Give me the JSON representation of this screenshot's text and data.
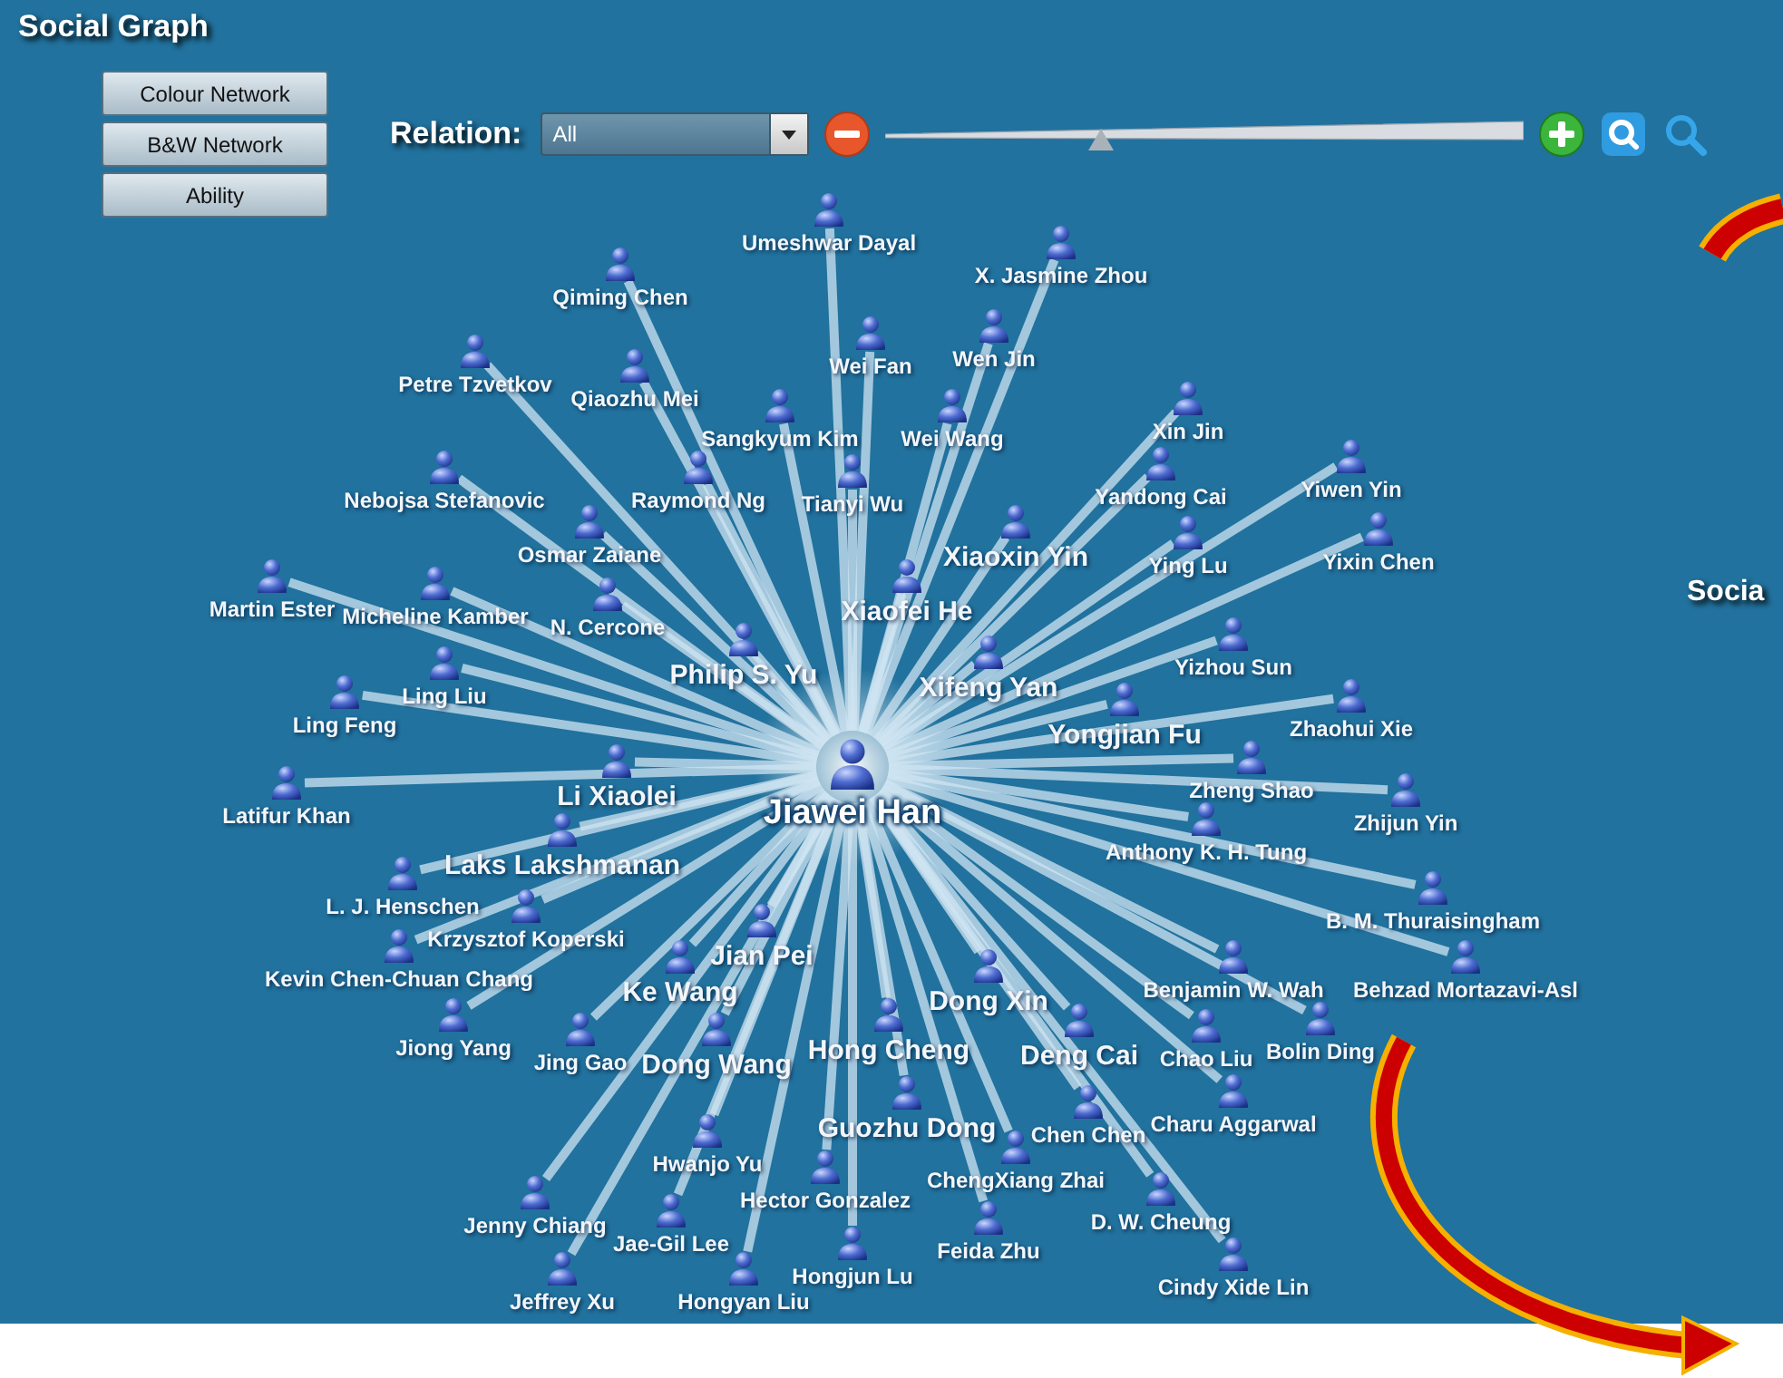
{
  "title": "Social Graph",
  "view_buttons": [
    "Colour Network",
    "B&W Network",
    "Ability"
  ],
  "relation": {
    "label": "Relation:",
    "value": "All"
  },
  "zoom": {
    "level": 0.34
  },
  "graph": {
    "center": {
      "name": "Jiawei Han"
    },
    "nodes": [
      {
        "name": "Umeshwar Dayal",
        "kind": "minor"
      },
      {
        "name": "X. Jasmine Zhou",
        "kind": "minor"
      },
      {
        "name": "Qiming Chen",
        "kind": "minor"
      },
      {
        "name": "Wen Jin",
        "kind": "minor"
      },
      {
        "name": "Wei Fan",
        "kind": "minor"
      },
      {
        "name": "Petre Tzvetkov",
        "kind": "minor"
      },
      {
        "name": "Qiaozhu Mei",
        "kind": "minor"
      },
      {
        "name": "Sangkyum Kim",
        "kind": "minor"
      },
      {
        "name": "Tianyi Wu",
        "kind": "minor"
      },
      {
        "name": "Wei Wang",
        "kind": "minor"
      },
      {
        "name": "Raymond Ng",
        "kind": "minor"
      },
      {
        "name": "Xin Jin",
        "kind": "minor"
      },
      {
        "name": "Yandong Cai",
        "kind": "minor"
      },
      {
        "name": "Yiwen Yin",
        "kind": "minor"
      },
      {
        "name": "Ying Lu",
        "kind": "minor"
      },
      {
        "name": "Yixin Chen",
        "kind": "minor"
      },
      {
        "name": "Nebojsa Stefanovic",
        "kind": "minor"
      },
      {
        "name": "Osmar Zaiane",
        "kind": "minor"
      },
      {
        "name": "Xiaoxin Yin",
        "kind": "major"
      },
      {
        "name": "Martin Ester",
        "kind": "minor"
      },
      {
        "name": "Micheline Kamber",
        "kind": "minor"
      },
      {
        "name": "N. Cercone",
        "kind": "minor"
      },
      {
        "name": "Xiaofei He",
        "kind": "major"
      },
      {
        "name": "Philip S. Yu",
        "kind": "major"
      },
      {
        "name": "Xifeng Yan",
        "kind": "major"
      },
      {
        "name": "Yizhou Sun",
        "kind": "minor"
      },
      {
        "name": "Ling Liu",
        "kind": "minor"
      },
      {
        "name": "Ling Feng",
        "kind": "minor"
      },
      {
        "name": "Yongjian Fu",
        "kind": "major"
      },
      {
        "name": "Zhaohui Xie",
        "kind": "minor"
      },
      {
        "name": "Zheng Shao",
        "kind": "minor"
      },
      {
        "name": "Zhijun Yin",
        "kind": "minor"
      },
      {
        "name": "Li Xiaolei",
        "kind": "major"
      },
      {
        "name": "Latifur Khan",
        "kind": "minor"
      },
      {
        "name": "Laks Lakshmanan",
        "kind": "major"
      },
      {
        "name": "Anthony K. H. Tung",
        "kind": "minor"
      },
      {
        "name": "L. J. Henschen",
        "kind": "minor"
      },
      {
        "name": "B. M. Thuraisingham",
        "kind": "minor"
      },
      {
        "name": "Krzysztof Koperski",
        "kind": "minor"
      },
      {
        "name": "Jian Pei",
        "kind": "major"
      },
      {
        "name": "Kevin Chen-Chuan Chang",
        "kind": "minor"
      },
      {
        "name": "Ke Wang",
        "kind": "major"
      },
      {
        "name": "Dong Xin",
        "kind": "major"
      },
      {
        "name": "Benjamin W. Wah",
        "kind": "minor"
      },
      {
        "name": "Behzad Mortazavi-Asl",
        "kind": "minor"
      },
      {
        "name": "Jiong Yang",
        "kind": "minor"
      },
      {
        "name": "Jing Gao",
        "kind": "minor"
      },
      {
        "name": "Dong Wang",
        "kind": "major"
      },
      {
        "name": "Hong Cheng",
        "kind": "major"
      },
      {
        "name": "Deng Cai",
        "kind": "major"
      },
      {
        "name": "Chao Liu",
        "kind": "minor"
      },
      {
        "name": "Bolin Ding",
        "kind": "minor"
      },
      {
        "name": "Guozhu Dong",
        "kind": "major"
      },
      {
        "name": "Chen Chen",
        "kind": "minor"
      },
      {
        "name": "Charu Aggarwal",
        "kind": "minor"
      },
      {
        "name": "Hwanjo Yu",
        "kind": "minor"
      },
      {
        "name": "Hector Gonzalez",
        "kind": "minor"
      },
      {
        "name": "ChengXiang Zhai",
        "kind": "minor"
      },
      {
        "name": "Jenny Chiang",
        "kind": "minor"
      },
      {
        "name": "Jae-Gil Lee",
        "kind": "minor"
      },
      {
        "name": "Feida Zhu",
        "kind": "minor"
      },
      {
        "name": "D. W. Cheung",
        "kind": "minor"
      },
      {
        "name": "Jeffrey Xu",
        "kind": "minor"
      },
      {
        "name": "Hongyan Liu",
        "kind": "minor"
      },
      {
        "name": "Hongjun Lu",
        "kind": "minor"
      },
      {
        "name": "Cindy Xide Lin",
        "kind": "minor"
      }
    ]
  },
  "side_label": "Socia"
}
